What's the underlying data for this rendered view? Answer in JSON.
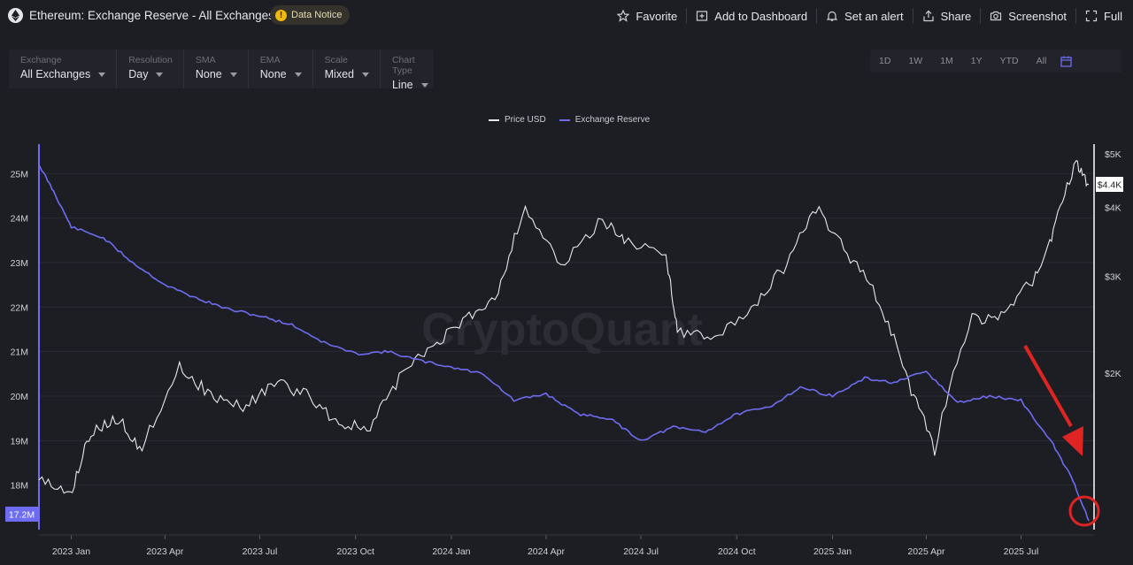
{
  "header": {
    "title": "Ethereum: Exchange Reserve - All Exchanges",
    "notice_label": "Data Notice",
    "actions": [
      {
        "label": "Favorite",
        "icon": "star-icon"
      },
      {
        "label": "Add to Dashboard",
        "icon": "dashboard-icon"
      },
      {
        "label": "Set an alert",
        "icon": "bell-icon"
      },
      {
        "label": "Share",
        "icon": "share-icon"
      },
      {
        "label": "Screenshot",
        "icon": "camera-icon"
      },
      {
        "label": "Full",
        "icon": "fullscreen-icon"
      }
    ]
  },
  "controls": [
    {
      "label": "Exchange",
      "value": "All Exchanges"
    },
    {
      "label": "Resolution",
      "value": "Day"
    },
    {
      "label": "SMA",
      "value": "None"
    },
    {
      "label": "EMA",
      "value": "None"
    },
    {
      "label": "Scale",
      "value": "Mixed"
    },
    {
      "label": "Chart Type",
      "value": "Line"
    }
  ],
  "ranges": [
    "1D",
    "1W",
    "1M",
    "1Y",
    "YTD",
    "All"
  ],
  "watermark": "CryptoQuant",
  "colors": {
    "price": "#e8e8ec",
    "reserve": "#6e6cf0",
    "arrow": "#e02424",
    "background": "#1d1e24"
  },
  "chart_data": {
    "type": "line",
    "legend": [
      "Price USD",
      "Exchange Reserve"
    ],
    "legend_placement": "top-center",
    "x_ticks": [
      "2023 Jan",
      "2023 Apr",
      "2023 Jul",
      "2023 Oct",
      "2024 Jan",
      "2024 Apr",
      "2024 Jul",
      "2024 Oct",
      "2025 Jan",
      "2025 Apr",
      "2025 Jul"
    ],
    "y_left_ticks": [
      "25M",
      "24M",
      "23M",
      "22M",
      "21M",
      "20M",
      "19M",
      "18M"
    ],
    "y_right_ticks": [
      "$5K",
      "$4K",
      "$3K",
      "$2K"
    ],
    "y_left_range": [
      17,
      25.8
    ],
    "y_right_scale": "log",
    "current_reserve_label": "17.2M",
    "current_price_label": "$4.4K",
    "grid": "horizontal",
    "annotations": [
      "red arrow pointing to latest value",
      "red circle around latest value"
    ],
    "x_range": [
      "2022-12-01",
      "2025-09-04"
    ],
    "series": [
      {
        "name": "Exchange Reserve",
        "axis": "left",
        "unit": "ETH",
        "points": [
          [
            "2022-12-01",
            25.2
          ],
          [
            "2022-12-15",
            24.6
          ],
          [
            "2023-01-01",
            23.8
          ],
          [
            "2023-02-01",
            23.55
          ],
          [
            "2023-03-01",
            23.0
          ],
          [
            "2023-04-01",
            22.5
          ],
          [
            "2023-05-01",
            22.2
          ],
          [
            "2023-06-01",
            21.95
          ],
          [
            "2023-07-01",
            21.8
          ],
          [
            "2023-08-01",
            21.6
          ],
          [
            "2023-09-01",
            21.2
          ],
          [
            "2023-10-01",
            20.95
          ],
          [
            "2023-11-01",
            21.0
          ],
          [
            "2023-12-01",
            20.8
          ],
          [
            "2024-01-01",
            20.65
          ],
          [
            "2024-02-01",
            20.5
          ],
          [
            "2024-03-01",
            19.9
          ],
          [
            "2024-04-01",
            20.05
          ],
          [
            "2024-05-01",
            19.6
          ],
          [
            "2024-06-01",
            19.5
          ],
          [
            "2024-07-01",
            19.0
          ],
          [
            "2024-08-01",
            19.3
          ],
          [
            "2024-09-01",
            19.2
          ],
          [
            "2024-10-01",
            19.6
          ],
          [
            "2024-11-01",
            19.75
          ],
          [
            "2024-12-01",
            20.2
          ],
          [
            "2025-01-01",
            20.0
          ],
          [
            "2025-02-01",
            20.4
          ],
          [
            "2025-03-01",
            20.3
          ],
          [
            "2025-04-01",
            20.55
          ],
          [
            "2025-05-01",
            19.85
          ],
          [
            "2025-06-01",
            20.0
          ],
          [
            "2025-07-01",
            19.9
          ],
          [
            "2025-08-01",
            18.9
          ],
          [
            "2025-08-20",
            18.1
          ],
          [
            "2025-09-04",
            17.2
          ]
        ]
      },
      {
        "name": "Price USD",
        "axis": "right",
        "unit": "USD",
        "points": [
          [
            "2022-12-01",
            1280
          ],
          [
            "2022-12-31",
            1200
          ],
          [
            "2023-01-20",
            1560
          ],
          [
            "2023-02-15",
            1650
          ],
          [
            "2023-03-10",
            1450
          ],
          [
            "2023-04-15",
            2050
          ],
          [
            "2023-05-15",
            1820
          ],
          [
            "2023-06-15",
            1730
          ],
          [
            "2023-07-15",
            1920
          ],
          [
            "2023-08-15",
            1830
          ],
          [
            "2023-09-15",
            1620
          ],
          [
            "2023-10-15",
            1580
          ],
          [
            "2023-11-15",
            2000
          ],
          [
            "2023-12-15",
            2250
          ],
          [
            "2024-01-15",
            2500
          ],
          [
            "2024-02-15",
            2800
          ],
          [
            "2024-03-12",
            4000
          ],
          [
            "2024-04-15",
            3100
          ],
          [
            "2024-05-25",
            3800
          ],
          [
            "2024-06-15",
            3500
          ],
          [
            "2024-07-25",
            3250
          ],
          [
            "2024-08-05",
            2400
          ],
          [
            "2024-09-06",
            2300
          ],
          [
            "2024-10-15",
            2600
          ],
          [
            "2024-11-15",
            3100
          ],
          [
            "2024-12-16",
            4000
          ],
          [
            "2025-01-15",
            3300
          ],
          [
            "2025-02-15",
            2700
          ],
          [
            "2025-03-15",
            1900
          ],
          [
            "2025-04-09",
            1450
          ],
          [
            "2025-05-15",
            2500
          ],
          [
            "2025-06-15",
            2550
          ],
          [
            "2025-07-15",
            3000
          ],
          [
            "2025-08-01",
            3600
          ],
          [
            "2025-08-23",
            4850
          ],
          [
            "2025-09-04",
            4400
          ]
        ]
      }
    ]
  }
}
